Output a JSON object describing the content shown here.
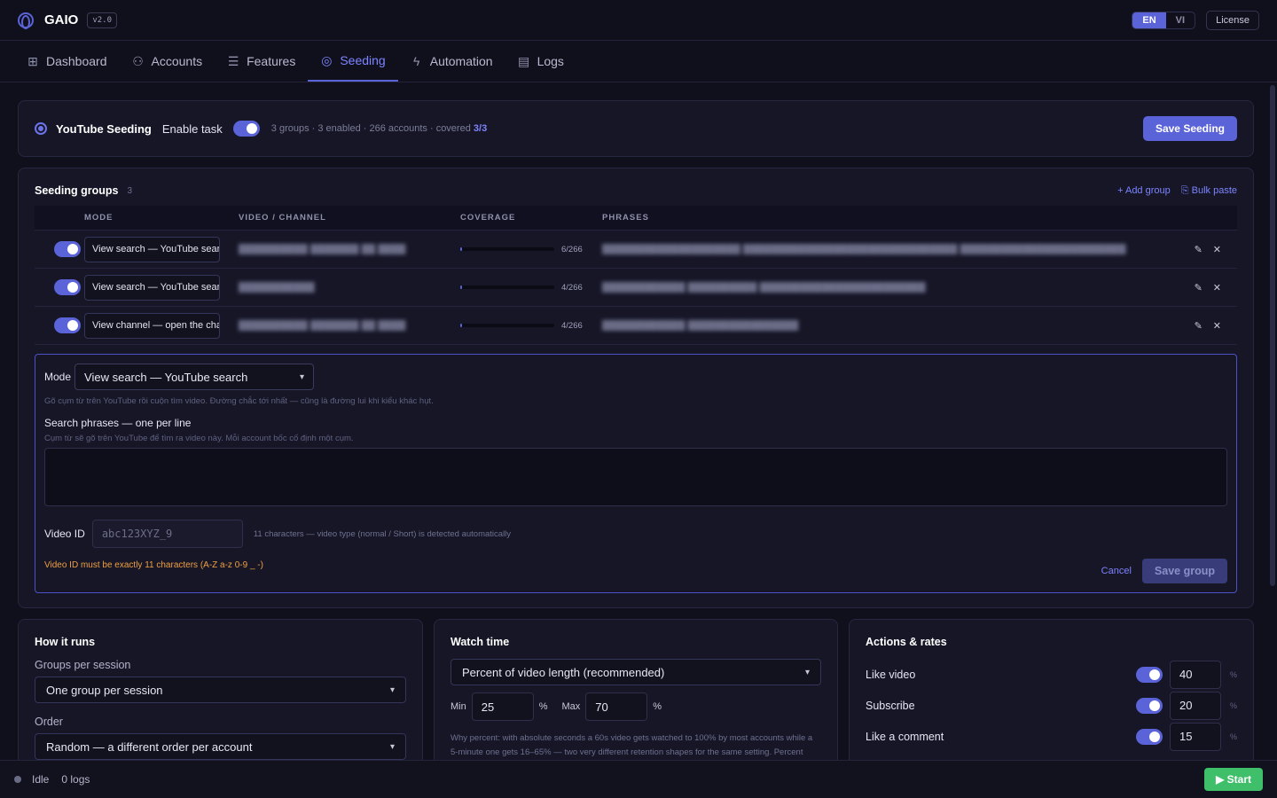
{
  "app": {
    "brand": "GAIO",
    "version": "v2.0",
    "languages": [
      "EN",
      "VI"
    ],
    "active_language": "EN",
    "license_label": "License"
  },
  "nav": [
    {
      "label": "Dashboard",
      "icon": "grid-icon"
    },
    {
      "label": "Accounts",
      "icon": "users-icon"
    },
    {
      "label": "Features",
      "icon": "sliders-icon"
    },
    {
      "label": "Seeding",
      "icon": "target-icon",
      "active": true
    },
    {
      "label": "Automation",
      "icon": "bolt-icon"
    },
    {
      "label": "Logs",
      "icon": "scroll-icon"
    }
  ],
  "task": {
    "title": "YouTube Seeding",
    "enable_label": "Enable task",
    "enabled": true,
    "stats": "3 groups · 3 enabled · 266 accounts · covered",
    "covered": "3/3",
    "save_label": "Save Seeding"
  },
  "groups": {
    "title": "Seeding groups",
    "count": "3",
    "add_label": "+ Add group",
    "bulk_label": "Bulk paste",
    "columns": [
      "MODE",
      "VIDEO / CHANNEL",
      "COVERAGE",
      "PHRASES"
    ],
    "rows": [
      {
        "enabled": true,
        "mode": "View search — YouTube search",
        "coverage": "6/266",
        "coverage_fraction": 0.023
      },
      {
        "enabled": true,
        "mode": "View search — YouTube search",
        "coverage": "4/266",
        "coverage_fraction": 0.015
      },
      {
        "enabled": true,
        "mode": "View channel — open the channel",
        "coverage": "4/266",
        "coverage_fraction": 0.015
      }
    ]
  },
  "editor": {
    "mode_label": "Mode",
    "mode_value": "View search — YouTube search",
    "mode_hint": "Gõ cụm từ trên YouTube rồi cuộn tìm video. Đường chắc tới nhất — cũng là đường lui khi kiểu khác hụt.",
    "phrases_label": "Search phrases — one per line",
    "phrases_hint": "Cụm từ sẽ gõ trên YouTube để tìm ra video này. Mỗi account bốc cố định một cụm.",
    "video_id_label": "Video ID",
    "video_id_placeholder": "abc123XYZ_9",
    "video_id_hint": "11 characters — video type (normal / Short) is detected automatically",
    "error": "Video ID must be exactly 11 characters (A-Z a-z 0-9 _ -)",
    "cancel_label": "Cancel",
    "save_group_label": "Save group"
  },
  "how": {
    "title": "How it runs",
    "groups_label": "Groups per session",
    "groups_value": "One group per session",
    "order_label": "Order",
    "order_value": "Random — a different order per account"
  },
  "watch": {
    "title": "Watch time",
    "mode_value": "Percent of video length (recommended)",
    "min_label": "Min",
    "min_value": "25",
    "max_label": "Max",
    "max_value": "70",
    "unit": "%",
    "why": "Why percent: with absolute seconds a 60s video gets watched to 100% by most accounts while a 5-minute one gets 16–65% — two very different retention shapes for the same setting. Percent keeps them comparable. Falls back to seconds when the length cannot be"
  },
  "actions": {
    "title": "Actions & rates",
    "items": [
      {
        "label": "Like video",
        "value": "40",
        "enabled": true
      },
      {
        "label": "Subscribe",
        "value": "20",
        "enabled": true
      },
      {
        "label": "Like a comment",
        "value": "15",
        "enabled": true
      }
    ],
    "unit": "%"
  },
  "status": {
    "state": "Idle",
    "logs": "0 logs",
    "start_label": "▶ Start"
  }
}
